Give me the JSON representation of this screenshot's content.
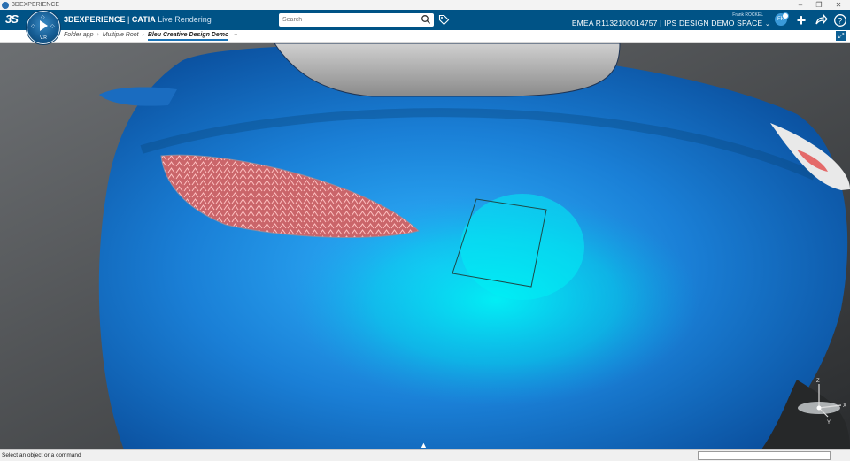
{
  "os_window": {
    "title": "3DEXPERIENCE",
    "minimize": "–",
    "maximize": "❐",
    "close": "✕"
  },
  "header": {
    "brand_bold": "3DEXPERIENCE",
    "brand_sep": " | ",
    "brand_product": "CATIA",
    "app_name": "Live Rendering",
    "compass_version": "V.R",
    "search_placeholder": "Search",
    "user_name": "Frank ROCKEL",
    "collab_space": "EMEA R1132100014757 | IPS DESIGN DEMO SPACE",
    "avatar_initials": "FR"
  },
  "tabs": {
    "breadcrumb": [
      "Folder app",
      "Multiple Root"
    ],
    "active_tab": "Bleu Creative Design Demo",
    "add_tab": "+"
  },
  "viewport": {
    "model_color": "#1a7fd6",
    "highlight_color": "#00e6f0",
    "compass_axes": [
      "Z",
      "X",
      "Y"
    ]
  },
  "status": {
    "message": "Select an object or a command"
  },
  "colors": {
    "topbar": "#005386",
    "accent": "#1a74b8"
  }
}
